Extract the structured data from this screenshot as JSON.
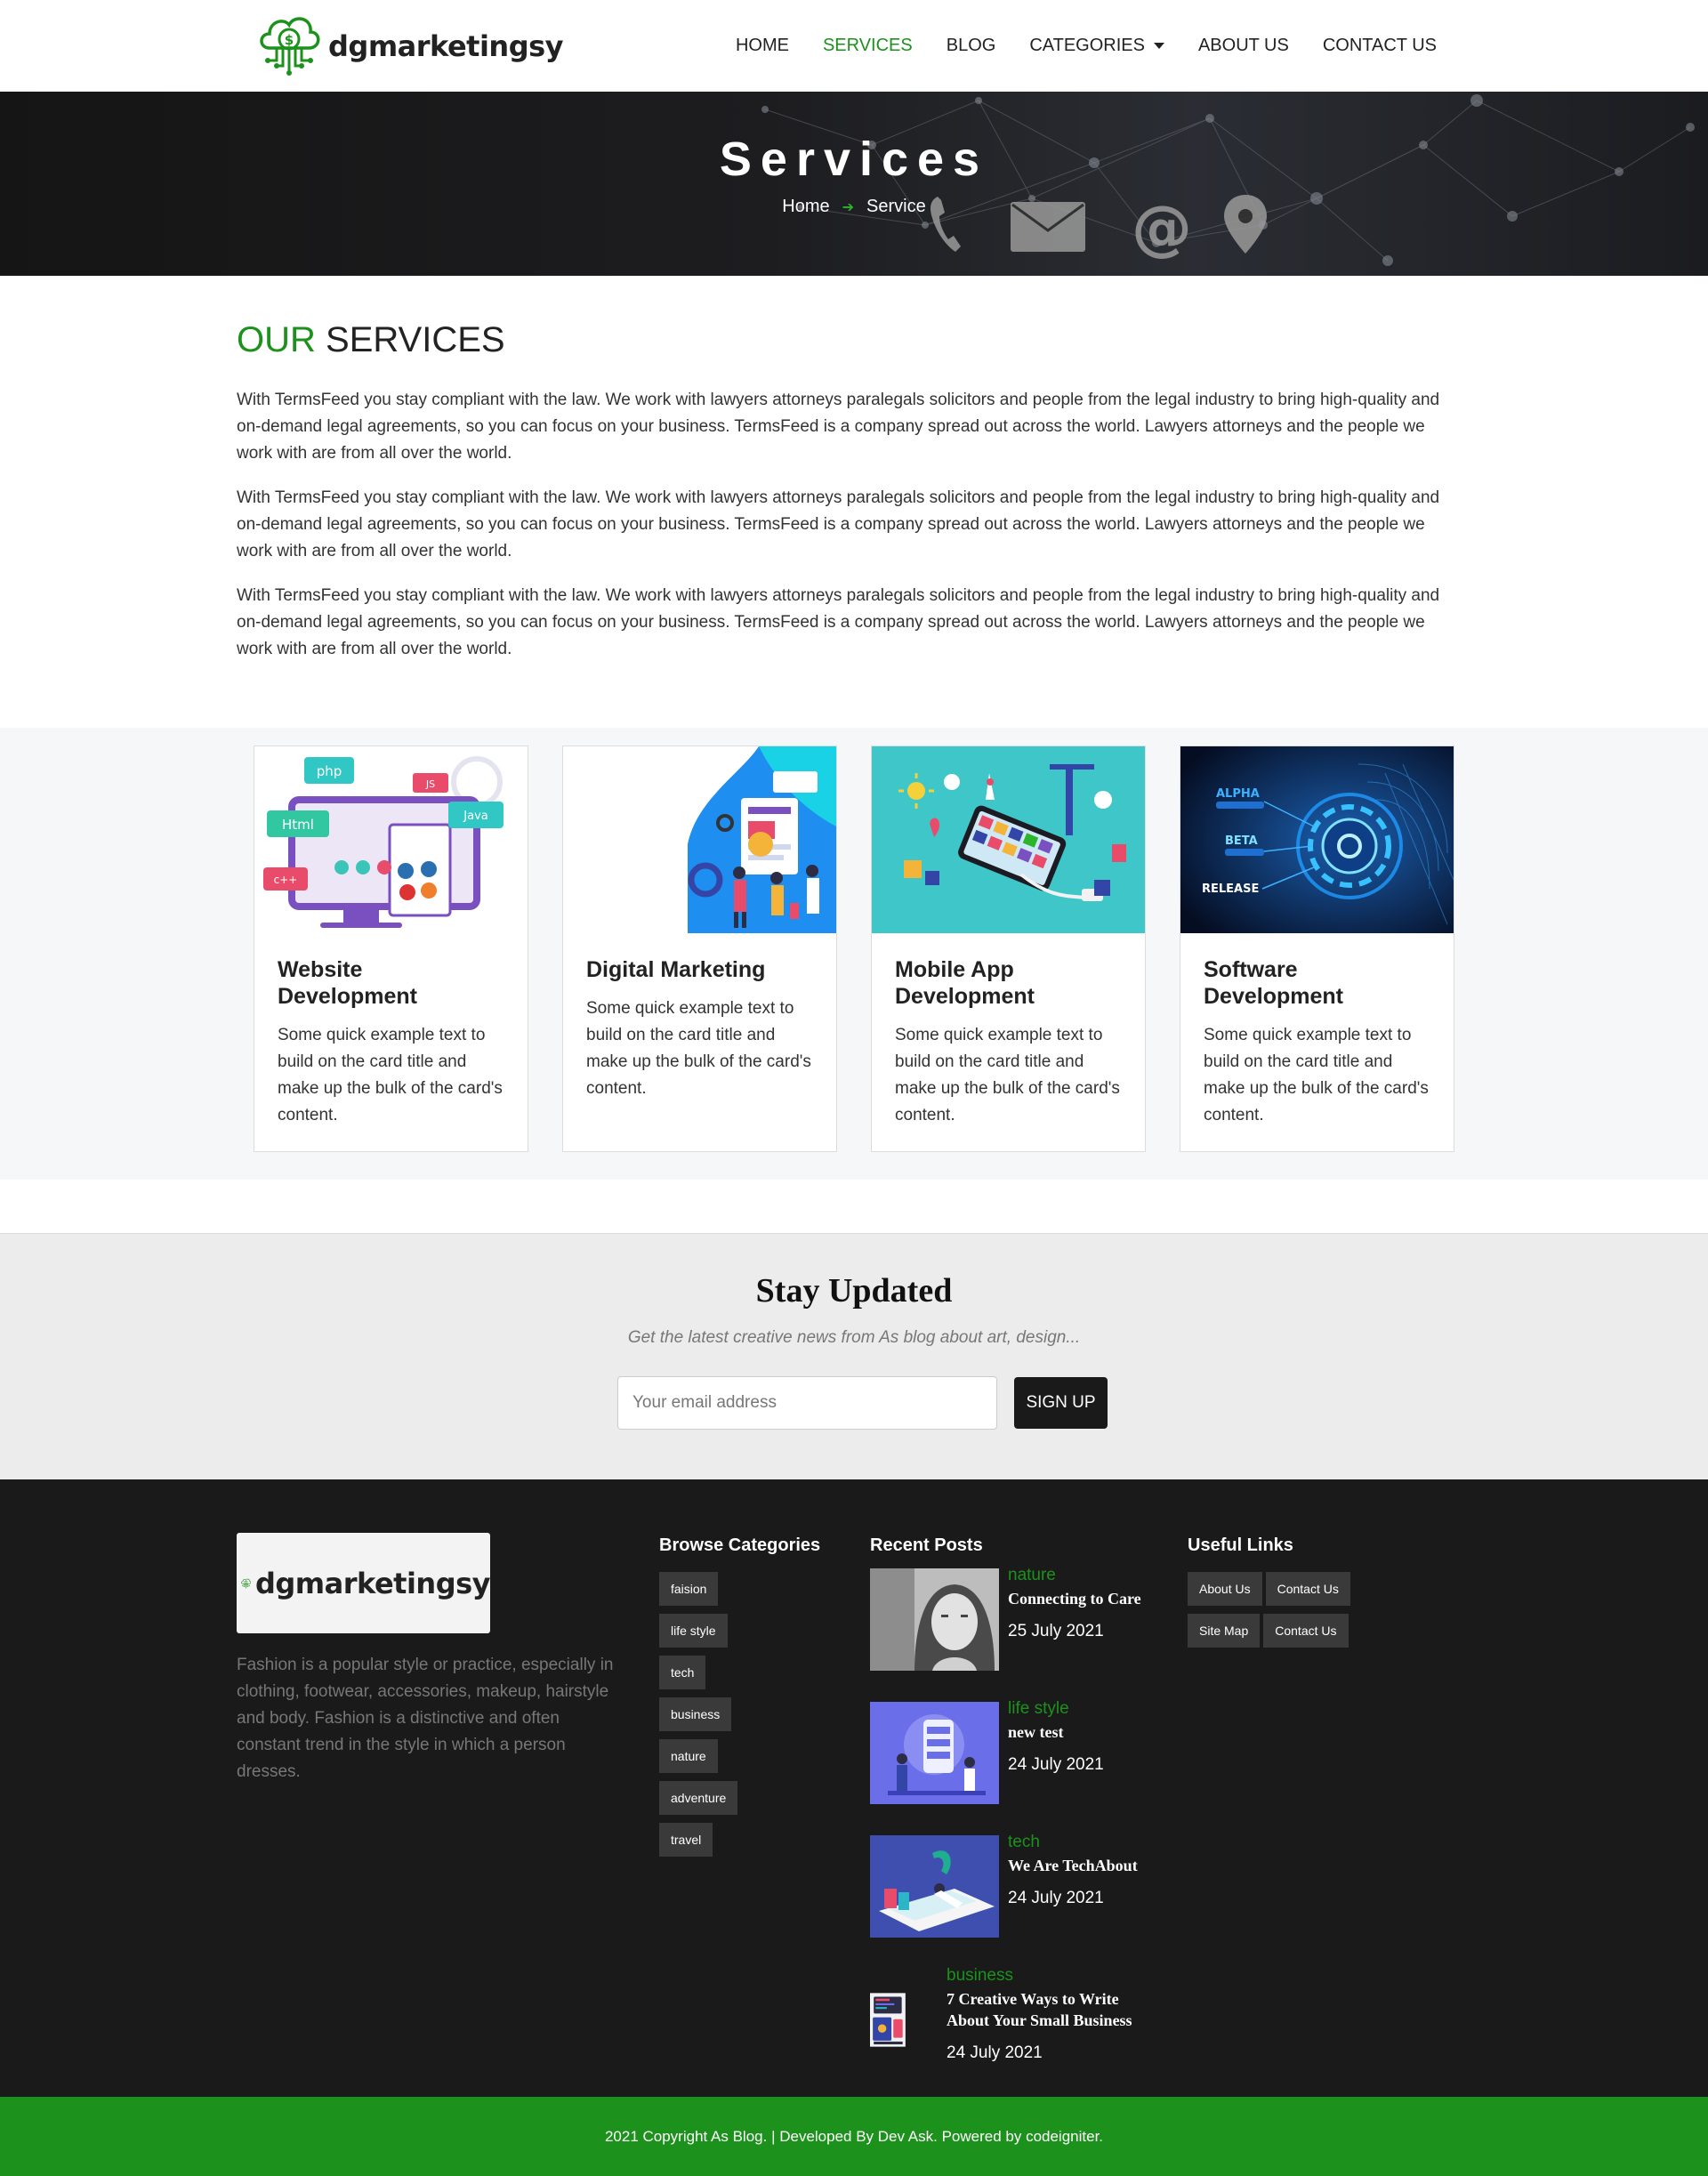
{
  "brand": {
    "name": "dgmarketingsy",
    "accent_color": "#1c921c"
  },
  "nav": {
    "items": [
      {
        "label": "HOME",
        "active": false
      },
      {
        "label": "SERVICES",
        "active": true
      },
      {
        "label": "BLOG",
        "active": false
      },
      {
        "label": "CATEGORIES",
        "active": false,
        "dropdown": true
      },
      {
        "label": "ABOUT US",
        "active": false
      },
      {
        "label": "CONTACT US",
        "active": false
      }
    ]
  },
  "hero": {
    "title": "Services",
    "breadcrumb": {
      "home": "Home",
      "current": "Service"
    }
  },
  "intro": {
    "heading_accent": "OUR",
    "heading_rest": "SERVICES",
    "paragraphs": [
      "With TermsFeed you stay compliant with the law. We work with lawyers attorneys paralegals solicitors and people from the legal industry to bring high-quality and on-demand legal agreements, so you can focus on your business. TermsFeed is a company spread out across the world. Lawyers attorneys and the people we work with are from all over the world.",
      "With TermsFeed you stay compliant with the law. We work with lawyers attorneys paralegals solicitors and people from the legal industry to bring high-quality and on-demand legal agreements, so you can focus on your business. TermsFeed is a company spread out across the world. Lawyers attorneys and the people we work with are from all over the world.",
      "With TermsFeed you stay compliant with the law. We work with lawyers attorneys paralegals solicitors and people from the legal industry to bring high-quality and on-demand legal agreements, so you can focus on your business. TermsFeed is a company spread out across the world. Lawyers attorneys and the people we work with are from all over the world."
    ]
  },
  "cards": [
    {
      "title": "Website Development",
      "text": "Some quick example text to build on the card title and make up the bulk of the card's content.",
      "image_labels": [
        "php",
        "JS",
        "Html",
        "Java",
        "c++"
      ]
    },
    {
      "title": "Digital Marketing",
      "text": "Some quick example text to build on the card title and make up the bulk of the card's content."
    },
    {
      "title": "Mobile App Development",
      "text": "Some quick example text to build on the card title and make up the bulk of the card's content."
    },
    {
      "title": "Software Development",
      "text": "Some quick example text to build on the card title and make up the bulk of the card's content.",
      "image_labels": [
        "ALPHA",
        "BETA",
        "RELEASE"
      ]
    }
  ],
  "newsletter": {
    "title": "Stay Updated",
    "subtitle": "Get the latest creative news from As blog about art, design...",
    "placeholder": "Your email address",
    "button": "SIGN UP"
  },
  "footer": {
    "description": "Fashion is a popular style or practice, especially in clothing, footwear, accessories, makeup, hairstyle and body. Fashion is a distinctive and often constant trend in the style in which a person dresses.",
    "categories_title": "Browse Categories",
    "categories": [
      "faision",
      "life style",
      "tech",
      "business",
      "nature",
      "adventure",
      "travel"
    ],
    "recent_title": "Recent Posts",
    "posts": [
      {
        "category": "nature",
        "title": "Connecting to Care",
        "date": "25 July 2021"
      },
      {
        "category": "life style",
        "title": "new test",
        "date": "24 July 2021"
      },
      {
        "category": "tech",
        "title": "We Are TechAbout",
        "date": "24 July 2021"
      },
      {
        "category": "business",
        "title": "7 Creative Ways to Write About Your Small Business",
        "date": "24 July 2021"
      }
    ],
    "useful_title": "Useful Links",
    "useful_links": [
      "About Us",
      "Contact Us",
      "Site Map",
      "Contact Us"
    ],
    "copyright": "2021 Copyright As Blog. | Developed By Dev Ask. Powered by codeigniter."
  }
}
